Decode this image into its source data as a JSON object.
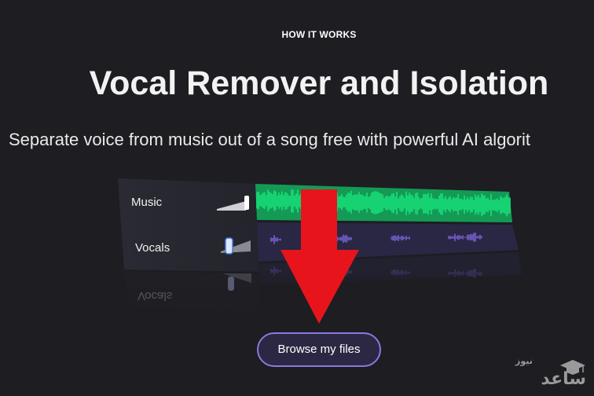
{
  "hero": {
    "eyebrow": "HOW IT WORKS",
    "title": "Vocal Remover and Isolation",
    "subtitle": "Separate voice from music out of a song free with powerful AI algorit"
  },
  "mixer": {
    "tracks": [
      {
        "label": "Music",
        "volume": 1.0,
        "color": "#16e07a"
      },
      {
        "label": "Vocals",
        "volume": 0.1,
        "color": "#7b63d6"
      }
    ],
    "reflection_label": "Vocals"
  },
  "cta": {
    "browse_label": "Browse my files"
  },
  "annotation": {
    "arrow_color": "#e8141c",
    "arrow_icon": "arrow-down-icon"
  },
  "watermark": {
    "brand": "ساعد",
    "sub": "نیوز"
  }
}
